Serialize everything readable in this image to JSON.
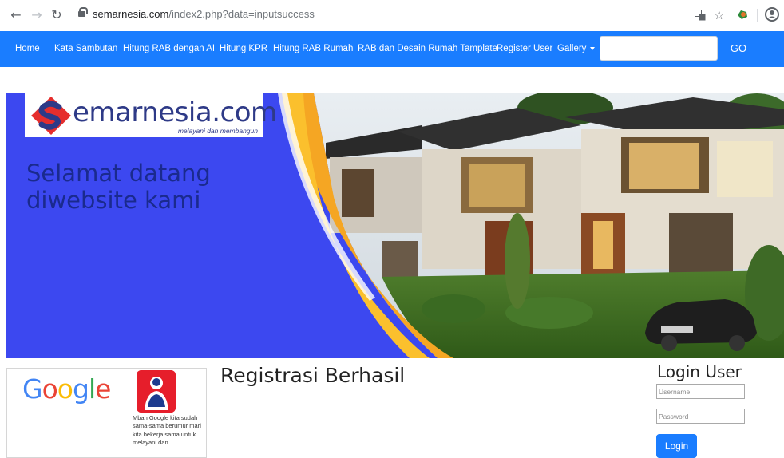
{
  "browser": {
    "url_domain": "semarnesia.com",
    "url_path": "/index2.php?data=inputsuccess",
    "back_icon": "arrow-left-icon",
    "forward_icon": "arrow-right-icon",
    "reload_icon": "reload-icon",
    "right_icons": [
      "translate-icon",
      "star-icon",
      "extension-icon",
      "profile-icon"
    ]
  },
  "navbar": {
    "color": "#1a7dff",
    "items": [
      {
        "label": "Home"
      },
      {
        "label": "Kata Sambutan"
      },
      {
        "label": "Hitung RAB dengan AI"
      },
      {
        "label": "Hitung KPR"
      },
      {
        "label": "Hitung RAB Rumah"
      },
      {
        "label": "RAB dan Desain Rumah Tamplate"
      },
      {
        "label": "Register User"
      },
      {
        "label": "Gallery"
      }
    ],
    "search_value": "",
    "go_label": "GO"
  },
  "hero": {
    "logo_text": "emarnesia.com",
    "logo_tagline": "melayani dan membangun",
    "welcome_text": "Selamat datang diwebsite kami",
    "colors": {
      "blue": "#3c48f0",
      "orange": "#f5a623",
      "logo_red": "#e62e2d",
      "logo_navy": "#2e3a87"
    }
  },
  "ad": {
    "google_letters": [
      {
        "ch": "G",
        "color": "#4285f4"
      },
      {
        "ch": "o",
        "color": "#ea4335"
      },
      {
        "ch": "o",
        "color": "#fbbc05"
      },
      {
        "ch": "g",
        "color": "#4285f4"
      },
      {
        "ch": "l",
        "color": "#34a853"
      },
      {
        "ch": "e",
        "color": "#ea4335"
      }
    ],
    "text": "Mbah Google kita sudah sama-sama berumur mari kita bekerja sama untuk melayani dan"
  },
  "main": {
    "title": "Registrasi Berhasil"
  },
  "login": {
    "title": "Login User",
    "username_placeholder": "Username",
    "password_placeholder": "Password",
    "button_label": "Login"
  }
}
